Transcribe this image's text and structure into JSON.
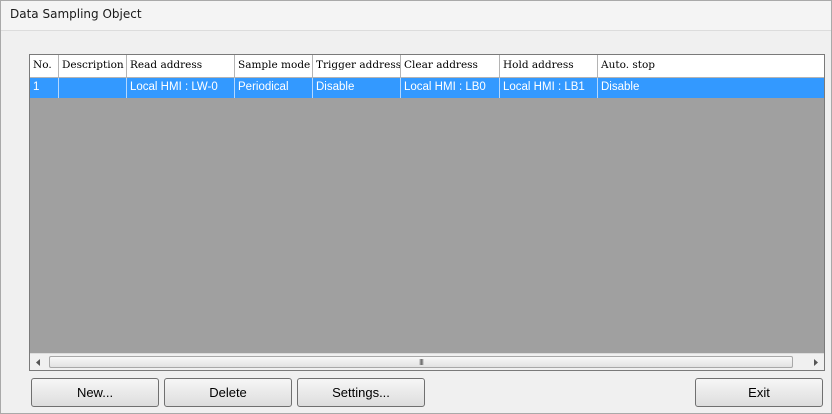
{
  "window": {
    "title": "Data Sampling Object"
  },
  "table": {
    "columns": [
      "No.",
      "Description",
      "Read address",
      "Sample mode",
      "Trigger address",
      "Clear address",
      "Hold address",
      "Auto. stop"
    ],
    "rows": [
      {
        "no": "1",
        "description": "",
        "read_address": "Local HMI : LW-0",
        "sample_mode": "Periodical",
        "trigger_address": "Disable",
        "clear_address": "Local HMI : LB0",
        "hold_address": "Local HMI : LB1",
        "auto_stop": "Disable",
        "selected": true
      }
    ],
    "selection_color": "#3399ff",
    "empty_area_color": "#a0a0a0"
  },
  "scrollbar": {
    "left_arrow_icon": "chevron-left-icon",
    "right_arrow_icon": "chevron-right-icon",
    "grip": "III"
  },
  "buttons": {
    "new_label": "New...",
    "delete_label": "Delete",
    "settings_label": "Settings...",
    "exit_label": "Exit"
  }
}
